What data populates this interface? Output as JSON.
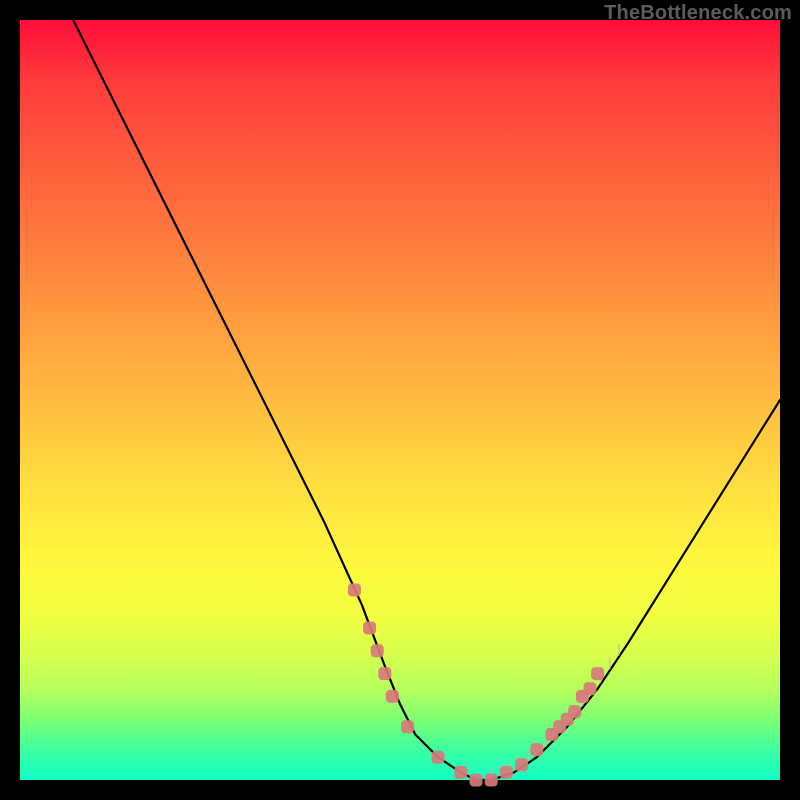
{
  "watermark": "TheBottleneck.com",
  "chart_data": {
    "type": "line",
    "title": "",
    "xlabel": "",
    "ylabel": "",
    "xlim": [
      0,
      100
    ],
    "ylim": [
      0,
      100
    ],
    "series": [
      {
        "name": "curve",
        "x": [
          7,
          10,
          15,
          20,
          25,
          30,
          35,
          40,
          45,
          48,
          50,
          52,
          55,
          58,
          60,
          62,
          65,
          68,
          72,
          76,
          80,
          85,
          90,
          95,
          100
        ],
        "y": [
          100,
          94,
          84,
          74,
          64,
          54,
          44,
          34,
          23,
          15,
          10,
          6,
          3,
          1,
          0,
          0,
          1,
          3,
          7,
          12,
          18,
          26,
          34,
          42,
          50
        ]
      }
    ],
    "markers": {
      "name": "highlight-dots",
      "color": "#d87a7a",
      "x": [
        44,
        46,
        47,
        48,
        49,
        51,
        55,
        58,
        60,
        62,
        64,
        66,
        68,
        70,
        71,
        72,
        73,
        74,
        75,
        76
      ],
      "y": [
        25,
        20,
        17,
        14,
        11,
        7,
        3,
        1,
        0,
        0,
        1,
        2,
        4,
        6,
        7,
        8,
        9,
        11,
        12,
        14
      ]
    }
  }
}
